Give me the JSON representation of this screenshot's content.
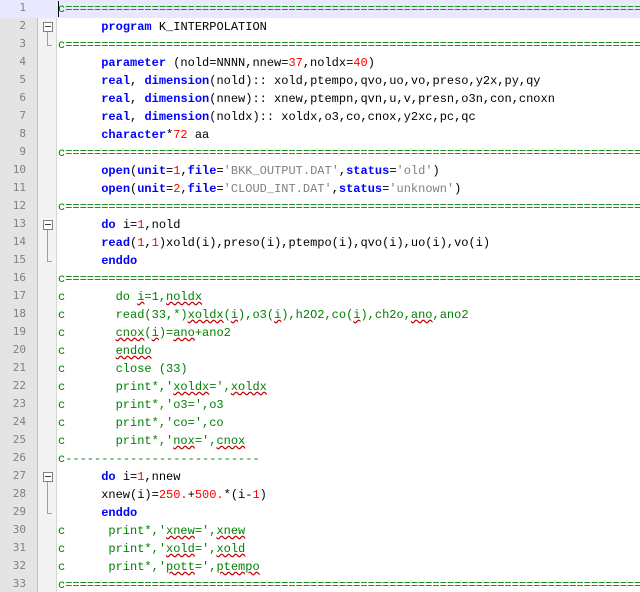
{
  "editor": {
    "lines": [
      {
        "n": "1",
        "fold": "",
        "segs": [
          [
            "c=====================================================================================",
            "cmt"
          ]
        ]
      },
      {
        "n": "2",
        "fold": "open",
        "segs": [
          [
            "      ",
            ""
          ],
          [
            "program",
            "kw"
          ],
          [
            " K_INTERPOLATION",
            ""
          ]
        ]
      },
      {
        "n": "3",
        "fold": "end",
        "segs": [
          [
            "c=====================================================================================",
            "cmt"
          ]
        ]
      },
      {
        "n": "4",
        "fold": "",
        "segs": [
          [
            "      ",
            ""
          ],
          [
            "parameter",
            "kw"
          ],
          [
            " (nold=NNNN,nnew=",
            ""
          ],
          [
            "37",
            "num"
          ],
          [
            ",noldx=",
            ""
          ],
          [
            "40",
            "num"
          ],
          [
            ")",
            ""
          ]
        ]
      },
      {
        "n": "5",
        "fold": "",
        "segs": [
          [
            "      ",
            ""
          ],
          [
            "real",
            "kw"
          ],
          [
            ", ",
            ""
          ],
          [
            "dimension",
            "kw"
          ],
          [
            "(nold):: xold,ptempo,qvo,uo,vo,preso,y2x,py,qy",
            ""
          ]
        ]
      },
      {
        "n": "6",
        "fold": "",
        "segs": [
          [
            "      ",
            ""
          ],
          [
            "real",
            "kw"
          ],
          [
            ", ",
            ""
          ],
          [
            "dimension",
            "kw"
          ],
          [
            "(nnew):: xnew,ptempn,qvn,u,v,presn,o3n,con,cnoxn",
            ""
          ]
        ]
      },
      {
        "n": "7",
        "fold": "",
        "segs": [
          [
            "      ",
            ""
          ],
          [
            "real",
            "kw"
          ],
          [
            ", ",
            ""
          ],
          [
            "dimension",
            "kw"
          ],
          [
            "(noldx):: xoldx,o3,co,cnox,y2xc,pc,qc",
            ""
          ]
        ]
      },
      {
        "n": "8",
        "fold": "",
        "segs": [
          [
            "      ",
            ""
          ],
          [
            "character",
            "kw"
          ],
          [
            "*",
            ""
          ],
          [
            "72",
            "num"
          ],
          [
            " aa",
            ""
          ]
        ]
      },
      {
        "n": "9",
        "fold": "",
        "segs": [
          [
            "c=====================================================================================",
            "cmt"
          ]
        ]
      },
      {
        "n": "10",
        "fold": "",
        "segs": [
          [
            "      ",
            ""
          ],
          [
            "open",
            "kw"
          ],
          [
            "(",
            ""
          ],
          [
            "unit",
            "kw"
          ],
          [
            "=",
            ""
          ],
          [
            "1",
            "num"
          ],
          [
            ",",
            ""
          ],
          [
            "file",
            "kw"
          ],
          [
            "=",
            ""
          ],
          [
            "'BKK_OUTPUT.DAT'",
            "str"
          ],
          [
            ",",
            ""
          ],
          [
            "status",
            "kw"
          ],
          [
            "=",
            ""
          ],
          [
            "'old'",
            "str"
          ],
          [
            ")",
            ""
          ]
        ]
      },
      {
        "n": "11",
        "fold": "",
        "segs": [
          [
            "      ",
            ""
          ],
          [
            "open",
            "kw"
          ],
          [
            "(",
            ""
          ],
          [
            "unit",
            "kw"
          ],
          [
            "=",
            ""
          ],
          [
            "2",
            "num"
          ],
          [
            ",",
            ""
          ],
          [
            "file",
            "kw"
          ],
          [
            "=",
            ""
          ],
          [
            "'CLOUD_INT.DAT'",
            "str"
          ],
          [
            ",",
            ""
          ],
          [
            "status",
            "kw"
          ],
          [
            "=",
            ""
          ],
          [
            "'unknown'",
            "str"
          ],
          [
            ")",
            ""
          ]
        ]
      },
      {
        "n": "12",
        "fold": "",
        "segs": [
          [
            "c=====================================================================================",
            "cmt"
          ]
        ]
      },
      {
        "n": "13",
        "fold": "open",
        "segs": [
          [
            "      ",
            ""
          ],
          [
            "do",
            "kw"
          ],
          [
            " i=",
            ""
          ],
          [
            "1",
            "num"
          ],
          [
            ",nold",
            ""
          ]
        ]
      },
      {
        "n": "14",
        "fold": "",
        "segs": [
          [
            "      ",
            ""
          ],
          [
            "read",
            "kw"
          ],
          [
            "(",
            ""
          ],
          [
            "1",
            "num"
          ],
          [
            ",",
            ""
          ],
          [
            "1",
            "num"
          ],
          [
            ")xold(i),preso(i),ptempo(i),qvo(i),uo(i),vo(i)",
            ""
          ]
        ]
      },
      {
        "n": "15",
        "fold": "end",
        "segs": [
          [
            "      ",
            ""
          ],
          [
            "enddo",
            "kw"
          ]
        ]
      },
      {
        "n": "16",
        "fold": "",
        "segs": [
          [
            "c=====================================================================================",
            "cmt"
          ]
        ]
      },
      {
        "n": "17",
        "fold": "",
        "segs": [
          [
            "c       do ",
            "cmt"
          ],
          [
            "i",
            "cmt sq"
          ],
          [
            "=1,",
            "cmt"
          ],
          [
            "noldx",
            "cmt sq"
          ]
        ]
      },
      {
        "n": "18",
        "fold": "",
        "segs": [
          [
            "c       read(33,*)",
            "cmt"
          ],
          [
            "xoldx",
            "cmt sq"
          ],
          [
            "(",
            "cmt"
          ],
          [
            "i",
            "cmt sq"
          ],
          [
            "),o3(",
            "cmt"
          ],
          [
            "i",
            "cmt sq"
          ],
          [
            "),h2O2,co(",
            "cmt"
          ],
          [
            "i",
            "cmt sq"
          ],
          [
            "),ch2o,",
            "cmt"
          ],
          [
            "ano",
            "cmt sq"
          ],
          [
            ",ano2",
            "cmt"
          ]
        ]
      },
      {
        "n": "19",
        "fold": "",
        "segs": [
          [
            "c       ",
            "cmt"
          ],
          [
            "cnox",
            "cmt sq"
          ],
          [
            "(",
            "cmt"
          ],
          [
            "i",
            "cmt sq"
          ],
          [
            ")=",
            "cmt"
          ],
          [
            "ano",
            "cmt sq"
          ],
          [
            "+ano2",
            "cmt"
          ]
        ]
      },
      {
        "n": "20",
        "fold": "",
        "segs": [
          [
            "c       ",
            "cmt"
          ],
          [
            "enddo",
            "cmt sq"
          ]
        ]
      },
      {
        "n": "21",
        "fold": "",
        "segs": [
          [
            "c       close (33)",
            "cmt"
          ]
        ]
      },
      {
        "n": "22",
        "fold": "",
        "segs": [
          [
            "c       print*,'",
            "cmt"
          ],
          [
            "xoldx",
            "cmt sq"
          ],
          [
            "=',",
            "cmt"
          ],
          [
            "xoldx",
            "cmt sq"
          ]
        ]
      },
      {
        "n": "23",
        "fold": "",
        "segs": [
          [
            "c       print*,'o3=',o3",
            "cmt"
          ]
        ]
      },
      {
        "n": "24",
        "fold": "",
        "segs": [
          [
            "c       print*,'co=',co",
            "cmt"
          ]
        ]
      },
      {
        "n": "25",
        "fold": "",
        "segs": [
          [
            "c       print*,'",
            "cmt"
          ],
          [
            "nox",
            "cmt sq"
          ],
          [
            "=',",
            "cmt"
          ],
          [
            "cnox",
            "cmt sq"
          ]
        ]
      },
      {
        "n": "26",
        "fold": "",
        "segs": [
          [
            "c---------------------------",
            "cmt"
          ]
        ]
      },
      {
        "n": "27",
        "fold": "open",
        "segs": [
          [
            "      ",
            ""
          ],
          [
            "do",
            "kw"
          ],
          [
            " i=",
            ""
          ],
          [
            "1",
            "num"
          ],
          [
            ",nnew",
            ""
          ]
        ]
      },
      {
        "n": "28",
        "fold": "",
        "segs": [
          [
            "      xnew(i)=",
            ""
          ],
          [
            "250.",
            "num"
          ],
          [
            "+",
            ""
          ],
          [
            "500.",
            "num"
          ],
          [
            "*(i-",
            ""
          ],
          [
            "1",
            "num"
          ],
          [
            ")",
            ""
          ]
        ]
      },
      {
        "n": "29",
        "fold": "end",
        "segs": [
          [
            "      ",
            ""
          ],
          [
            "enddo",
            "kw"
          ]
        ]
      },
      {
        "n": "30",
        "fold": "",
        "segs": [
          [
            "c      print*,'",
            "cmt"
          ],
          [
            "xnew",
            "cmt sq"
          ],
          [
            "=',",
            "cmt"
          ],
          [
            "xnew",
            "cmt sq"
          ]
        ]
      },
      {
        "n": "31",
        "fold": "",
        "segs": [
          [
            "c      print*,'",
            "cmt"
          ],
          [
            "xold",
            "cmt sq"
          ],
          [
            "=',",
            "cmt"
          ],
          [
            "xold",
            "cmt sq"
          ]
        ]
      },
      {
        "n": "32",
        "fold": "",
        "segs": [
          [
            "c      print*,'",
            "cmt"
          ],
          [
            "pott",
            "cmt sq"
          ],
          [
            "=',",
            "cmt"
          ],
          [
            "ptempo",
            "cmt sq"
          ]
        ]
      },
      {
        "n": "33",
        "fold": "",
        "segs": [
          [
            "c=====================================================================================",
            "cmt"
          ]
        ]
      }
    ]
  }
}
